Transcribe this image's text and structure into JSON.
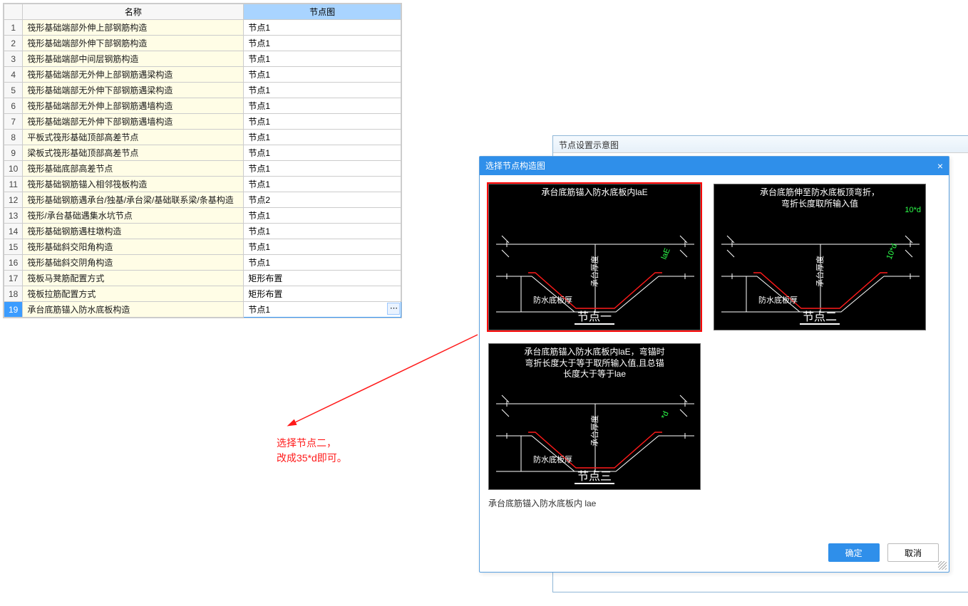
{
  "table": {
    "headers": {
      "idx": "",
      "name": "名称",
      "val": "节点图"
    },
    "rows": [
      {
        "n": "1",
        "name": "筏形基础端部外伸上部钢筋构造",
        "val": "节点1"
      },
      {
        "n": "2",
        "name": "筏形基础端部外伸下部钢筋构造",
        "val": "节点1"
      },
      {
        "n": "3",
        "name": "筏形基础端部中间层钢筋构造",
        "val": "节点1"
      },
      {
        "n": "4",
        "name": "筏形基础端部无外伸上部钢筋遇梁构造",
        "val": "节点1"
      },
      {
        "n": "5",
        "name": "筏形基础端部无外伸下部钢筋遇梁构造",
        "val": "节点1"
      },
      {
        "n": "6",
        "name": "筏形基础端部无外伸上部钢筋遇墙构造",
        "val": "节点1"
      },
      {
        "n": "7",
        "name": "筏形基础端部无外伸下部钢筋遇墙构造",
        "val": "节点1"
      },
      {
        "n": "8",
        "name": "平板式筏形基础顶部高差节点",
        "val": "节点1"
      },
      {
        "n": "9",
        "name": "梁板式筏形基础顶部高差节点",
        "val": "节点1"
      },
      {
        "n": "10",
        "name": "筏形基础底部高差节点",
        "val": "节点1"
      },
      {
        "n": "11",
        "name": "筏形基础钢筋锚入相邻筏板构造",
        "val": "节点1"
      },
      {
        "n": "12",
        "name": "筏形基础钢筋遇承台/独基/承台梁/基础联系梁/条基构造",
        "val": "节点2"
      },
      {
        "n": "13",
        "name": "筏形/承台基础遇集水坑节点",
        "val": "节点1"
      },
      {
        "n": "14",
        "name": "筏形基础钢筋遇柱墩构造",
        "val": "节点1"
      },
      {
        "n": "15",
        "name": "筏形基础斜交阳角构造",
        "val": "节点1"
      },
      {
        "n": "16",
        "name": "筏形基础斜交阴角构造",
        "val": "节点1"
      },
      {
        "n": "17",
        "name": "筏板马凳筋配置方式",
        "val": "矩形布置"
      },
      {
        "n": "18",
        "name": "筏板拉筋配置方式",
        "val": "矩形布置"
      },
      {
        "n": "19",
        "name": "承台底筋锚入防水底板构造",
        "val": "节点1",
        "sel": true
      }
    ],
    "ellips": "⋯"
  },
  "back_win": {
    "title": "节点设置示意图"
  },
  "dialog": {
    "title": "选择节点构造图",
    "close": "×",
    "options": [
      {
        "title": "承台底筋锚入防水底板内laE",
        "sub": "节点一",
        "sel": true,
        "dim": "laE",
        "thick_label": "防水底板厚",
        "height_label": "承台厚度"
      },
      {
        "title": "承台底筋伸至防水底板顶弯折，\n弯折长度取所输入值",
        "sub": "节点二",
        "dim": "10*d",
        "thick_label": "防水底板厚",
        "height_label": "承台厚度"
      },
      {
        "title": "承台底筋锚入防水底板内laE，弯锚时\n弯折长度大于等于取所输入值,且总锚\n长度大于等于lae",
        "sub": "节点三",
        "dim": "*d",
        "thick_label": "防水底板厚",
        "height_label": "承台厚度"
      }
    ],
    "desc": "承台底筋锚入防水底板内 lae",
    "ok": "确定",
    "cancel": "取消"
  },
  "note": {
    "l1": "选择节点二，",
    "l2": "改成35*d即可。"
  }
}
